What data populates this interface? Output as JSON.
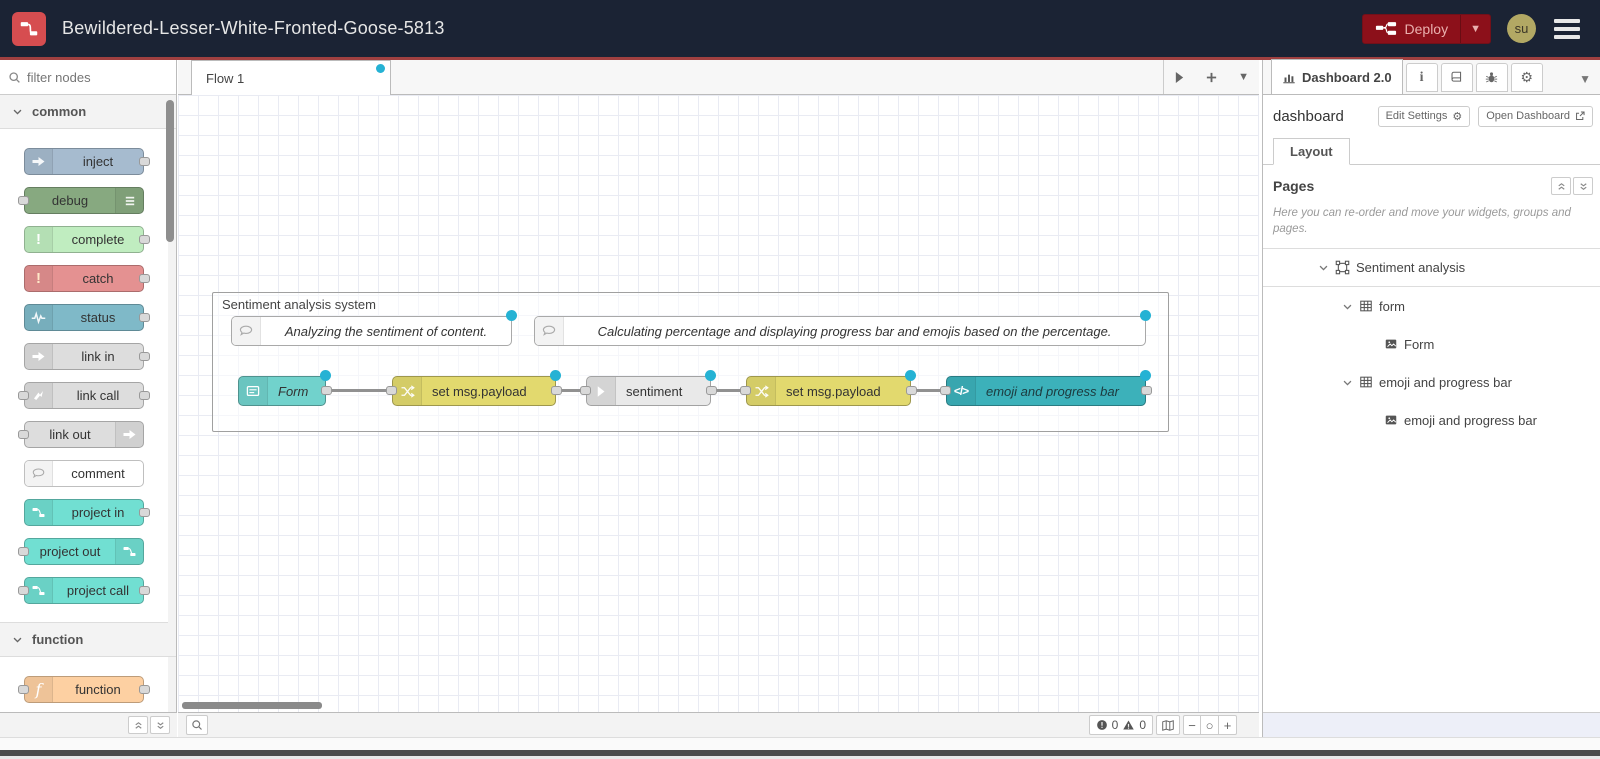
{
  "header": {
    "title": "Bewildered-Lesser-White-Fronted-Goose-5813",
    "deploy_label": "Deploy",
    "avatar_initials": "su"
  },
  "palette": {
    "filter_placeholder": "filter nodes",
    "categories": [
      {
        "label": "common",
        "nodes": [
          {
            "label": "inject",
            "color": "#a6bbcf",
            "icon": "arrow-in-icon",
            "ports": "out"
          },
          {
            "label": "debug",
            "color": "#87a980",
            "icon": "debug-list-icon",
            "ports": "in"
          },
          {
            "label": "complete",
            "color": "#c0edc0",
            "icon": "exclamation-icon",
            "ports": "out"
          },
          {
            "label": "catch",
            "color": "#e49191",
            "icon": "exclamation-icon",
            "ports": "out"
          },
          {
            "label": "status",
            "color": "#7fb9c8",
            "icon": "pulse-icon",
            "ports": "out"
          },
          {
            "label": "link in",
            "color": "#dddddd",
            "icon": "link-arrow-icon",
            "ports": "out"
          },
          {
            "label": "link call",
            "color": "#dddddd",
            "icon": "link-arrow-icon",
            "ports": "in-out"
          },
          {
            "label": "link out",
            "color": "#dddddd",
            "icon": "link-arrow-icon",
            "ports": "in"
          },
          {
            "label": "comment",
            "color": "#ffffff",
            "icon": "comment-bubble-icon",
            "ports": "none"
          },
          {
            "label": "project in",
            "color": "#71dfd2",
            "icon": "project-icon",
            "ports": "out"
          },
          {
            "label": "project out",
            "color": "#71dfd2",
            "icon": "project-icon",
            "ports": "in"
          },
          {
            "label": "project call",
            "color": "#71dfd2",
            "icon": "project-icon",
            "ports": "in-out"
          }
        ]
      },
      {
        "label": "function",
        "nodes": [
          {
            "label": "function",
            "color": "#fdd0a2",
            "icon": "function-f-icon",
            "ports": "in-out"
          }
        ]
      }
    ]
  },
  "workspace": {
    "tab_label": "Flow 1",
    "group_title": "Sentiment analysis system",
    "comments": [
      {
        "text": "Analyzing the sentiment of content."
      },
      {
        "text": "Calculating percentage and displaying progress bar and emojis based on the percentage."
      }
    ],
    "nodes": [
      {
        "label": "Form",
        "color": "#71d2cc",
        "icon": "form-icon"
      },
      {
        "label": "set msg.payload",
        "color": "#e2d96e",
        "icon": "shuffle-icon"
      },
      {
        "label": "sentiment",
        "color": "#e9e9e9",
        "icon": "arrow-right-icon"
      },
      {
        "label": "set msg.payload",
        "color": "#e2d96e",
        "icon": "shuffle-icon"
      },
      {
        "label": "emoji and progress bar",
        "color": "#3cb1ba",
        "icon": "code-icon",
        "code_glyph": "</>"
      }
    ],
    "footer": {
      "error_count": "0",
      "warning_count": "0",
      "zoom_out": "−",
      "zoom_reset": "○",
      "zoom_in": "+"
    }
  },
  "sidebar": {
    "tab_label": "Dashboard 2.0",
    "section_label": "dashboard",
    "edit_settings_label": "Edit Settings",
    "open_dashboard_label": "Open Dashboard",
    "layout_tab_label": "Layout",
    "pages_title": "Pages",
    "help_text": "Here you can re-order and move your widgets, groups and pages.",
    "tree": [
      {
        "label": "Sentiment analysis",
        "type": "page"
      },
      {
        "label": "form",
        "type": "group"
      },
      {
        "label": "Form",
        "type": "widget"
      },
      {
        "label": "emoji and progress bar",
        "type": "group"
      },
      {
        "label": "emoji and progress bar",
        "type": "widget"
      }
    ]
  },
  "colors": {
    "header_bg": "#1b2334",
    "header_underline": "#a04040",
    "logo_red": "#d64d50",
    "deploy_red": "#8c101a",
    "avatar_bg": "#b2a864",
    "badge_cyan": "#25b2d4",
    "grid_line": "#e9ebf3"
  }
}
